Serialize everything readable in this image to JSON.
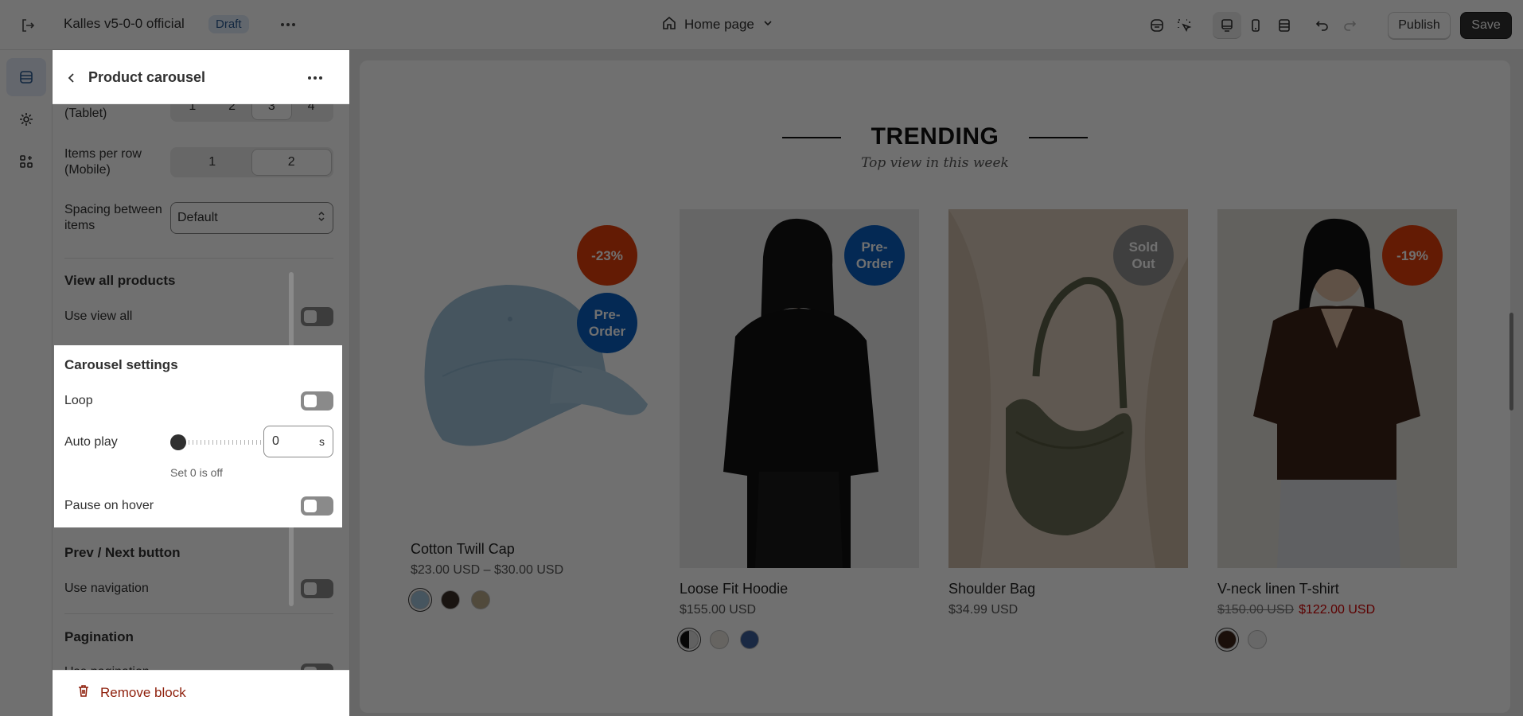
{
  "topbar": {
    "store_name": "Kalles v5-0-0 official",
    "status_badge": "Draft",
    "page_selector": "Home page",
    "publish_label": "Publish",
    "save_label": "Save"
  },
  "panel": {
    "title": "Product carousel",
    "items_tablet_label": "(Tablet)",
    "items_tablet_options": [
      "1",
      "2",
      "3",
      "4"
    ],
    "items_tablet_selected": "3",
    "items_mobile_label_1": "Items per row",
    "items_mobile_label_2": "(Mobile)",
    "items_mobile_options": [
      "1",
      "2"
    ],
    "items_mobile_selected": "2",
    "spacing_label_1": "Spacing between",
    "spacing_label_2": "items",
    "spacing_value": "Default",
    "view_all_title": "View all products",
    "use_view_all_label": "Use view all",
    "carousel_title": "Carousel settings",
    "loop_label": "Loop",
    "autoplay_label": "Auto play",
    "autoplay_value": "0",
    "autoplay_unit": "s",
    "autoplay_help": "Set 0 is off",
    "pause_label": "Pause on hover",
    "nav_title": "Prev / Next button",
    "use_navigation_label": "Use navigation",
    "pagination_title": "Pagination",
    "use_pagination_label": "Use pagination",
    "remove_label": "Remove block"
  },
  "preview": {
    "heading": "TRENDING",
    "subheading": "Top view in this week",
    "products": [
      {
        "name": "Cotton Twill Cap",
        "price": "$23.00 USD – $30.00 USD",
        "badges": [
          "-23%",
          "Pre-\nOrder"
        ]
      },
      {
        "name": "Loose Fit Hoodie",
        "price": "$155.00 USD",
        "badges": [
          "Pre-\nOrder"
        ]
      },
      {
        "name": "Shoulder Bag",
        "price": "$34.99 USD",
        "badges": [
          "Sold\nOut"
        ]
      },
      {
        "name": "V-neck linen T-shirt",
        "old_price": "$150.00 USD",
        "new_price": "$122.00 USD",
        "badges": [
          "-19%"
        ]
      }
    ]
  },
  "colors": {
    "sale_badge": "#e23f0b",
    "preorder_badge": "#0a5fc0",
    "soldout_badge": "#8f8f8f",
    "sale_price": "#d10000",
    "remove_text": "#8e1f0b"
  }
}
